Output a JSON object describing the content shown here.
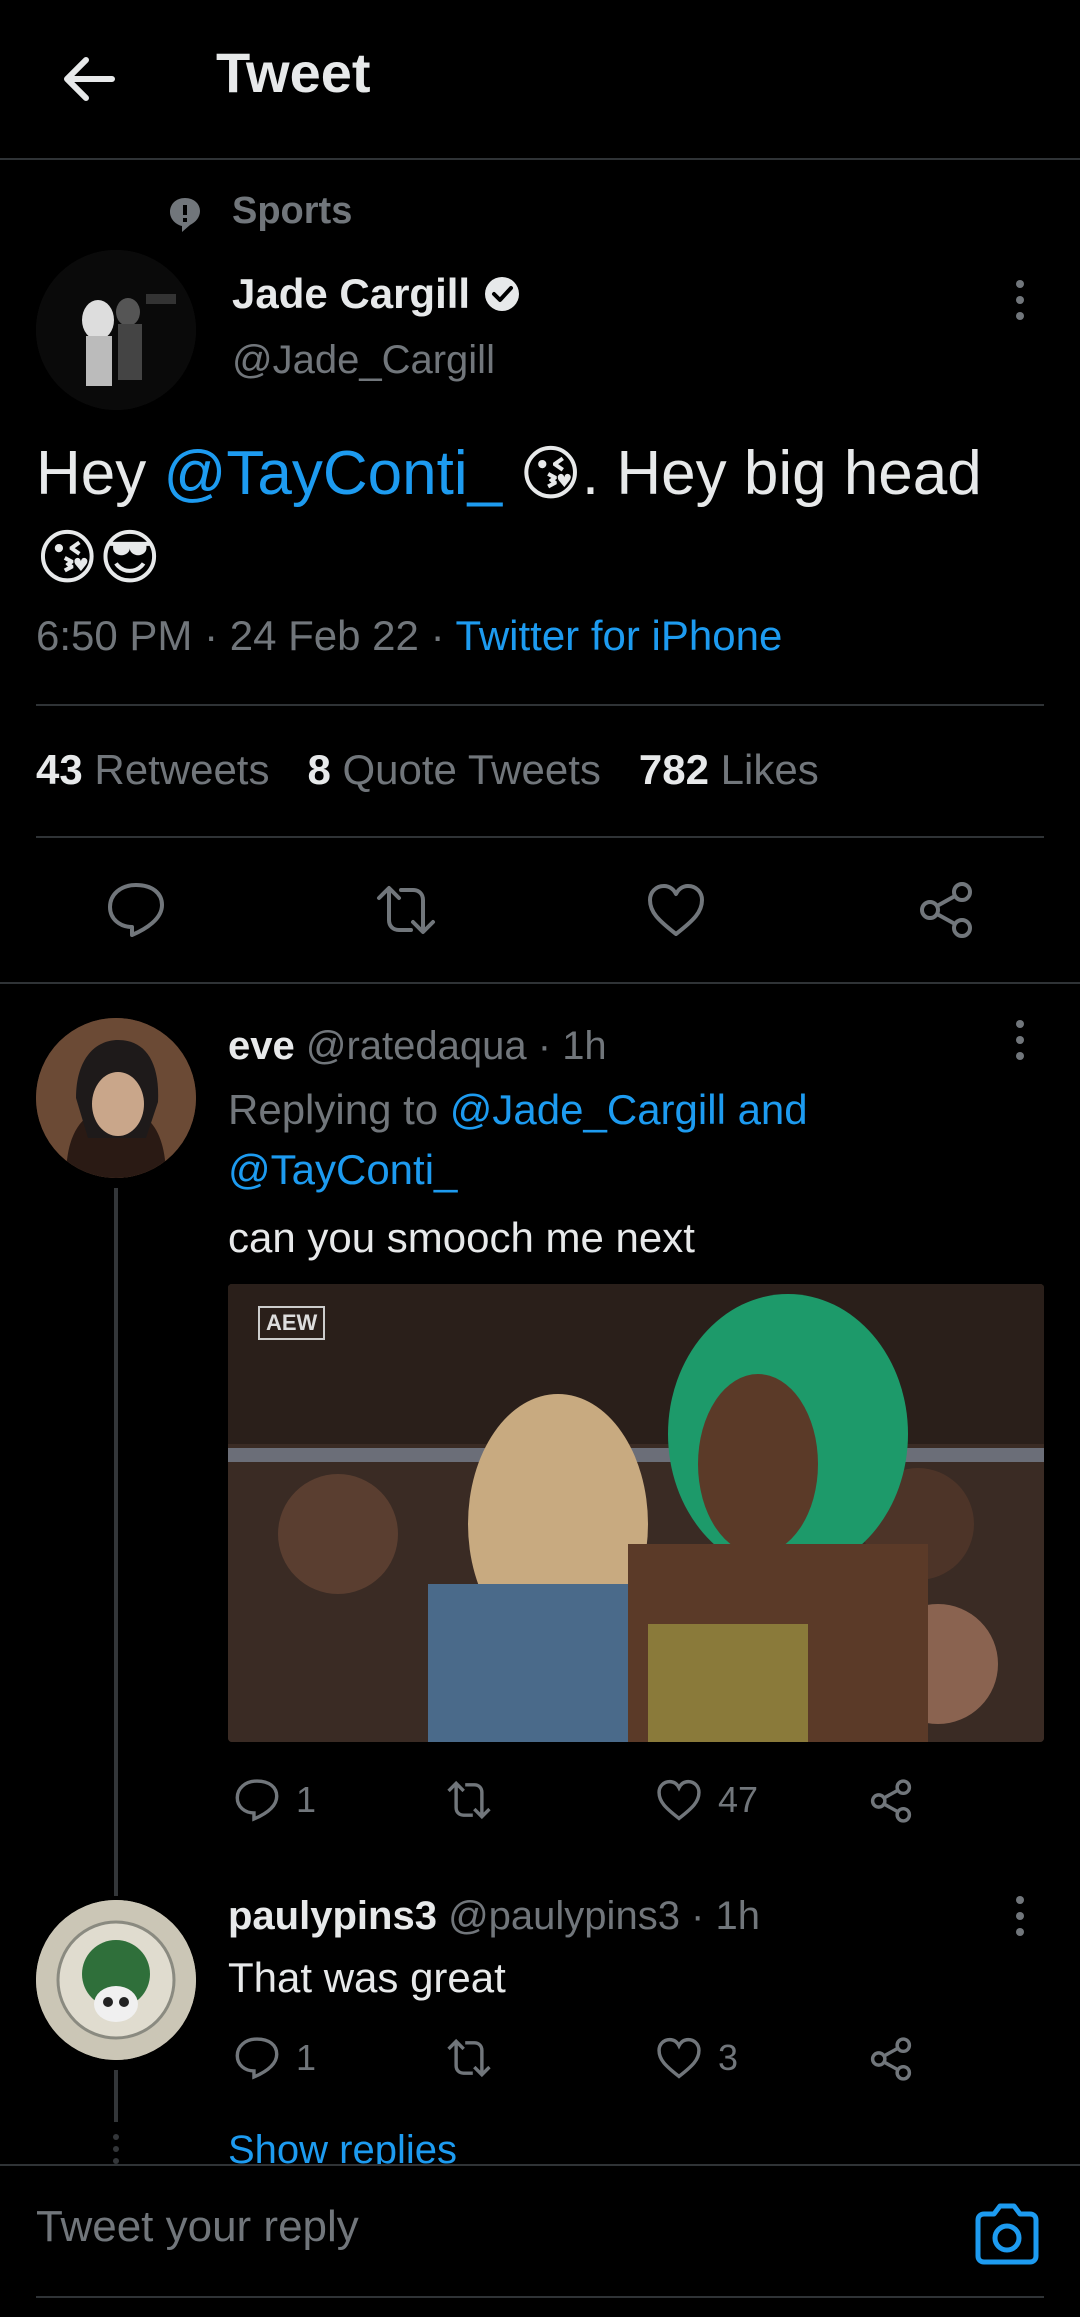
{
  "header": {
    "title": "Tweet",
    "back_icon": "arrow-left-icon"
  },
  "tweet": {
    "topic": "Sports",
    "author_name": "Jade Cargill",
    "author_handle": "@Jade_Cargill",
    "text_parts": [
      "Hey ",
      "@TayConti_",
      " ",
      "😘",
      ". Hey big head",
      "😘😎"
    ],
    "time": "6:50 PM",
    "date": "24 Feb 22",
    "source": "Twitter for iPhone",
    "stats": {
      "retweets_count": "43",
      "retweets_label": "Retweets",
      "quotes_count": "8",
      "quotes_label": "Quote Tweets",
      "likes_count": "782",
      "likes_label": "Likes"
    }
  },
  "replies": [
    {
      "name": "eve",
      "handle": "@ratedaqua",
      "time": "1h",
      "replying_prefix": "Replying to",
      "replying_to_1": "@Jade_Cargill and",
      "replying_to_2": "@TayConti_",
      "text": "can you smooch me next",
      "media_logo": "AEW",
      "reply_count": "1",
      "retweet_count": "",
      "like_count": "47"
    },
    {
      "name": "paulypins3",
      "handle": "@paulypins3",
      "time": "1h",
      "text": "That was great",
      "reply_count": "1",
      "retweet_count": "",
      "like_count": "3"
    }
  ],
  "show_replies_label": "Show replies",
  "composer": {
    "placeholder": "Tweet your reply",
    "camera_icon": "camera-icon"
  },
  "colors": {
    "accent": "#1d9bf0",
    "background": "#000000",
    "muted": "#71767b",
    "text": "#e7e9ea",
    "divider": "#2f3336"
  }
}
